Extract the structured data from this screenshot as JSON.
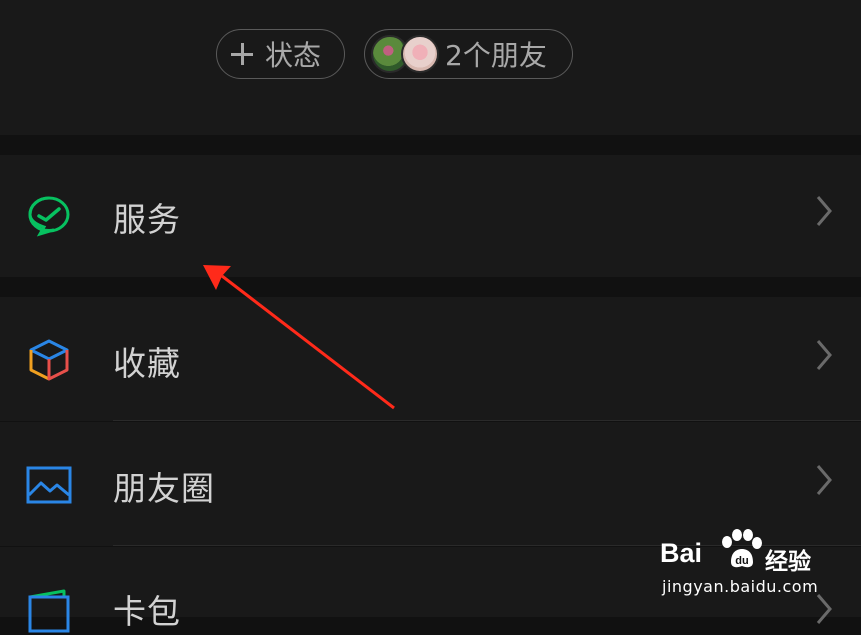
{
  "header": {
    "status_pill": {
      "label": "状态"
    },
    "friends_pill": {
      "label": "2个朋友"
    }
  },
  "menu": {
    "items": [
      {
        "label": "服务",
        "icon": "service-icon",
        "color": "#07c160"
      },
      {
        "label": "收藏",
        "icon": "favorites-cube-icon",
        "color": "#f0a020"
      },
      {
        "label": "朋友圈",
        "icon": "moments-picture-icon",
        "color": "#2a86e6"
      },
      {
        "label": "卡包",
        "icon": "wallet-card-icon",
        "color": "#2a86e6"
      }
    ]
  },
  "annotation": {
    "arrow_color": "#ff2a1a"
  },
  "watermark": {
    "brand": "Bai",
    "suffix": "经验",
    "url": "jingyan.baidu.com"
  }
}
